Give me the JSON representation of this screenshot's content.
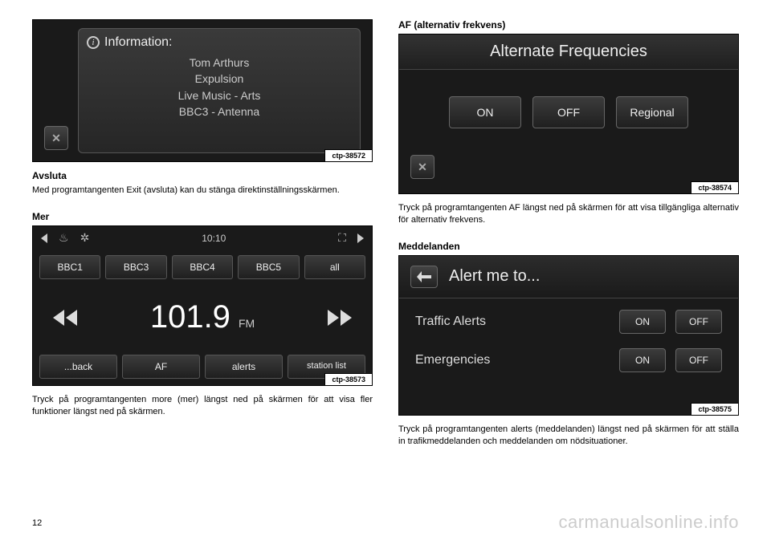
{
  "page_number": "12",
  "watermark": "carmanualsonline.info",
  "left": {
    "fig1": {
      "caption": "ctp-38572",
      "title": "Information:",
      "lines": [
        "Tom Arthurs",
        "Expulsion",
        "Live Music - Arts",
        "BBC3 - Antenna"
      ],
      "close": "✕"
    },
    "sec1": {
      "heading": "Avsluta",
      "text": "Med programtangenten Exit (avsluta) kan du stänga direktinställningsskärmen."
    },
    "sec2": {
      "heading": "Mer"
    },
    "fig2": {
      "caption": "ctp-38573",
      "time": "10:10",
      "presets": [
        "BBC1",
        "BBC3",
        "BBC4",
        "BBC5",
        "all"
      ],
      "frequency": "101.9",
      "band": "FM",
      "bottom": [
        "...back",
        "AF",
        "alerts",
        "station list"
      ]
    },
    "sec3": {
      "text": "Tryck på programtangenten more (mer) längst ned på skärmen för att visa fler funktioner längst ned på skärmen."
    }
  },
  "right": {
    "sec1": {
      "heading": "AF (alternativ frekvens)"
    },
    "fig3": {
      "caption": "ctp-38574",
      "title": "Alternate Frequencies",
      "buttons": [
        "ON",
        "OFF",
        "Regional"
      ],
      "close": "✕"
    },
    "sec2": {
      "text": "Tryck på programtangenten AF längst ned på skärmen för att visa tillgängliga alternativ för alternativ frekvens."
    },
    "sec3": {
      "heading": "Meddelanden"
    },
    "fig4": {
      "caption": "ctp-38575",
      "title": "Alert me to...",
      "rows": [
        {
          "label": "Traffic Alerts",
          "on": "ON",
          "off": "OFF"
        },
        {
          "label": "Emergencies",
          "on": "ON",
          "off": "OFF"
        }
      ]
    },
    "sec4": {
      "text": "Tryck på programtangenten alerts (meddelanden) längst ned på skärmen för att ställa in trafikmeddelanden och meddelanden om nödsituationer."
    }
  }
}
